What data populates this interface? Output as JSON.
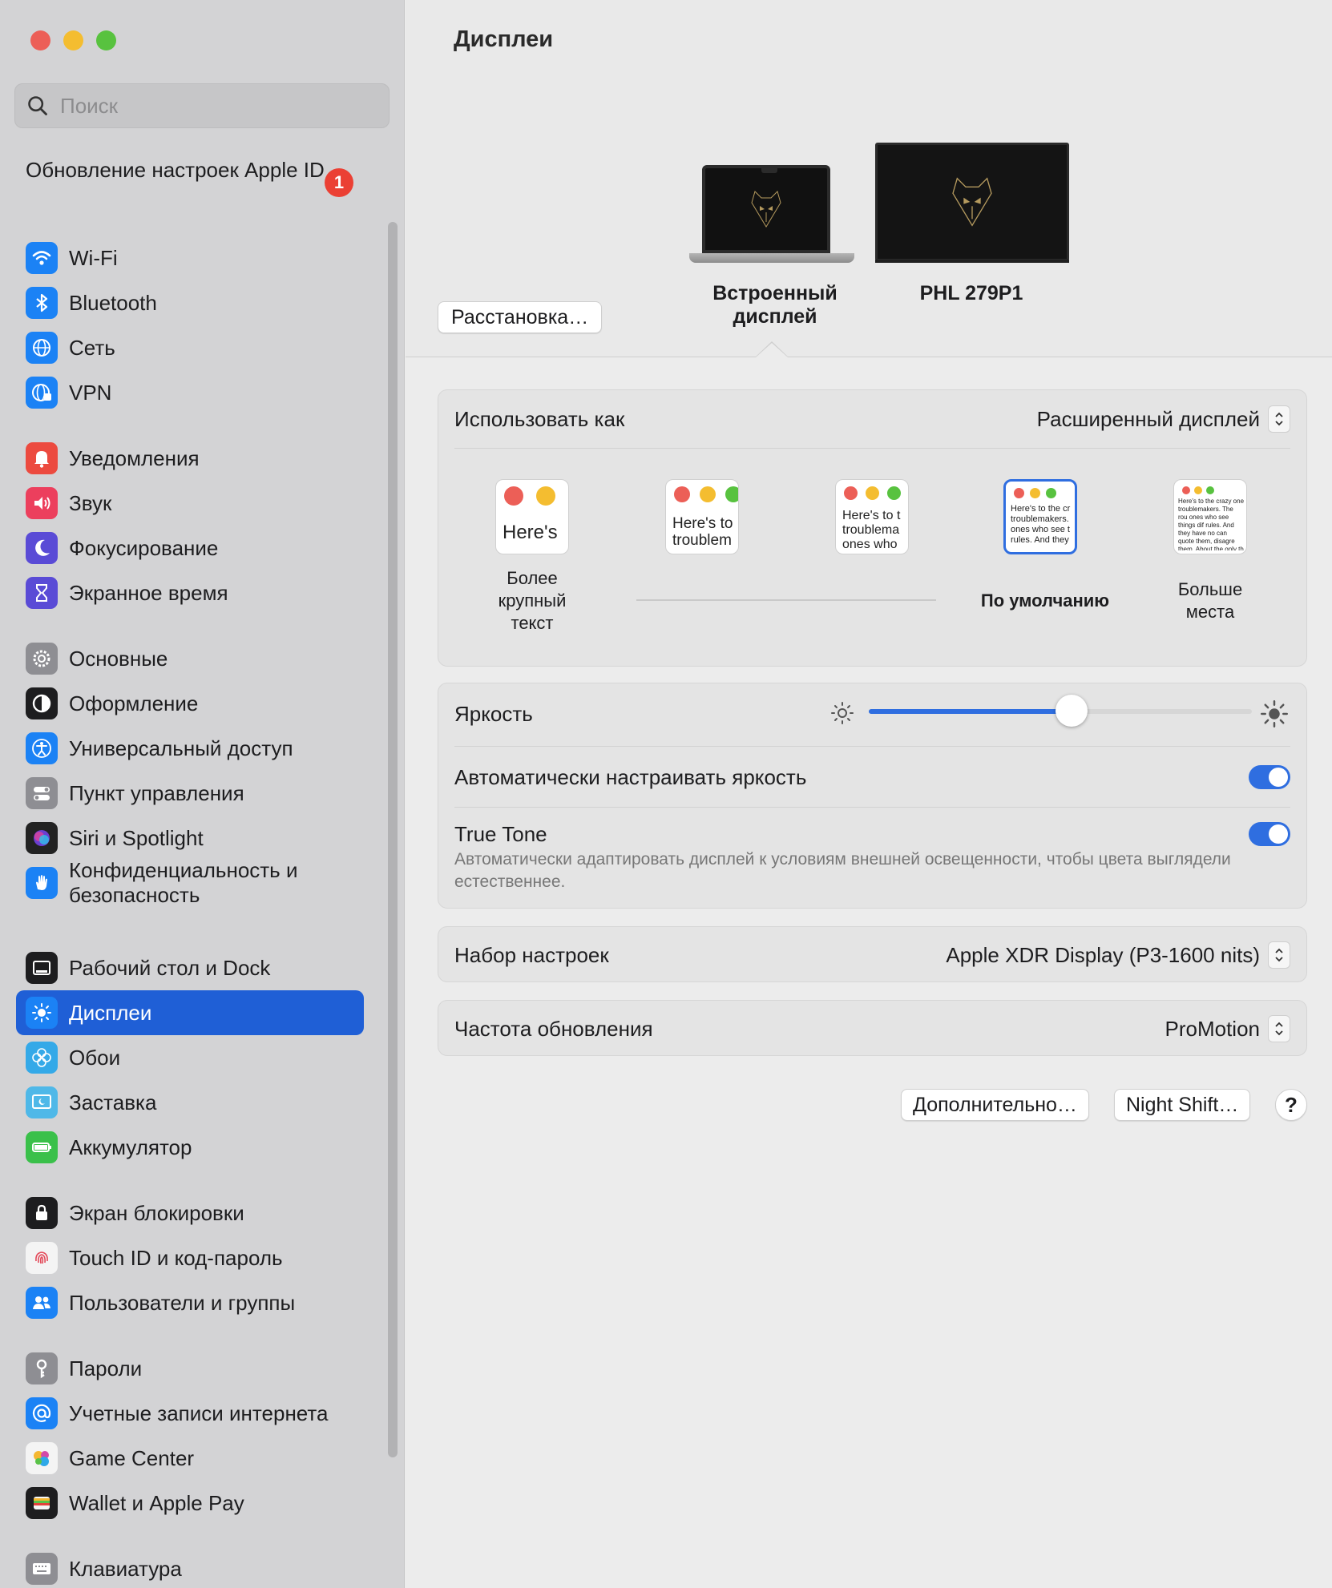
{
  "window": {
    "title": "Дисплеи"
  },
  "sidebar": {
    "search_placeholder": "Поиск",
    "apple_id": {
      "label": "Обновление настроек Apple ID",
      "badge": "1"
    },
    "items": [
      {
        "label": "Wi-Fi",
        "icon": "wifi-icon",
        "color": "#1b82f5"
      },
      {
        "label": "Bluetooth",
        "icon": "bluetooth-icon",
        "color": "#1b82f5"
      },
      {
        "label": "Сеть",
        "icon": "globe-icon",
        "color": "#1b82f5"
      },
      {
        "label": "VPN",
        "icon": "vpn-globe-icon",
        "color": "#1b82f5"
      },
      {
        "label": "Уведомления",
        "icon": "bell-icon",
        "color": "#ec4a3f"
      },
      {
        "label": "Звук",
        "icon": "speaker-icon",
        "color": "#ec3f5d"
      },
      {
        "label": "Фокусирование",
        "icon": "moon-icon",
        "color": "#5a4bd6"
      },
      {
        "label": "Экранное время",
        "icon": "hourglass-icon",
        "color": "#5a4bd6"
      },
      {
        "label": "Основные",
        "icon": "gear-icon",
        "color": "#8e8e93"
      },
      {
        "label": "Оформление",
        "icon": "appearance-icon",
        "color": "#1d1d1f"
      },
      {
        "label": "Универсальный доступ",
        "icon": "accessibility-icon",
        "color": "#1b82f5"
      },
      {
        "label": "Пункт управления",
        "icon": "control-center-icon",
        "color": "#8e8e93"
      },
      {
        "label": "Siri и Spotlight",
        "icon": "siri-icon",
        "color": "#222"
      },
      {
        "label": "Конфиденциальность и безопасность",
        "icon": "hand-icon",
        "color": "#1b82f5"
      },
      {
        "label": "Рабочий стол и Dock",
        "icon": "dock-icon",
        "color": "#1d1d1f"
      },
      {
        "label": "Дисплеи",
        "icon": "sun-icon",
        "color": "#1b82f5"
      },
      {
        "label": "Обои",
        "icon": "flower-icon",
        "color": "#34a9e8"
      },
      {
        "label": "Заставка",
        "icon": "screensaver-icon",
        "color": "#4fb8e8"
      },
      {
        "label": "Аккумулятор",
        "icon": "battery-icon",
        "color": "#3ac04a"
      },
      {
        "label": "Экран блокировки",
        "icon": "lock-icon",
        "color": "#1d1d1f"
      },
      {
        "label": "Touch ID и код-пароль",
        "icon": "fingerprint-icon",
        "color": "#f4f4f4"
      },
      {
        "label": "Пользователи и группы",
        "icon": "users-icon",
        "color": "#1b82f5"
      },
      {
        "label": "Пароли",
        "icon": "key-icon",
        "color": "#8e8e93"
      },
      {
        "label": "Учетные записи интернета",
        "icon": "at-icon",
        "color": "#1b82f5"
      },
      {
        "label": "Game Center",
        "icon": "game-center-icon",
        "color": "#f4f4f4"
      },
      {
        "label": "Wallet и Apple Pay",
        "icon": "wallet-icon",
        "color": "#1d1d1f"
      },
      {
        "label": "Клавиатура",
        "icon": "keyboard-icon",
        "color": "#8e8e93"
      }
    ],
    "selected": "Дисплеи"
  },
  "displays": {
    "arrange_button": "Расстановка…",
    "builtin_label": "Встроенный дисплей",
    "external_label": "PHL 279P1"
  },
  "use_as": {
    "label": "Использовать как",
    "value": "Расширенный дисплей",
    "resolutions": [
      {
        "label": "Более крупный текст",
        "preview": "Here's"
      },
      {
        "label": "",
        "preview": "Here's to troublem"
      },
      {
        "label": "",
        "preview": "Here's to t troublema ones who"
      },
      {
        "label": "По умолчанию",
        "preview": "Here's to the cr troublemakers. ones who see t rules. And they"
      },
      {
        "label": "Больше места",
        "preview": "Here's to the crazy one troublemakers. The rou ones who see things dif rules. And they have no can quote them, disagre them. About the only th Because they change tr"
      }
    ]
  },
  "brightness": {
    "label": "Яркость",
    "level": 0.53,
    "auto_label": "Автоматически настраивать яркость",
    "auto_on": true,
    "true_tone_label": "True Tone",
    "true_tone_desc": "Автоматически адаптировать дисплей к условиям внешней освещенности, чтобы цвета выглядели естественнее.",
    "true_tone_on": true
  },
  "preset": {
    "label": "Набор настроек",
    "value": "Apple XDR Display (P3-1600 nits)"
  },
  "refresh": {
    "label": "Частота обновления",
    "value": "ProMotion"
  },
  "buttons": {
    "advanced": "Дополнительно…",
    "night_shift": "Night Shift…",
    "help": "?"
  },
  "colors": {
    "accent": "#2f6ee0",
    "selected_sidebar": "#1f5fd6"
  }
}
